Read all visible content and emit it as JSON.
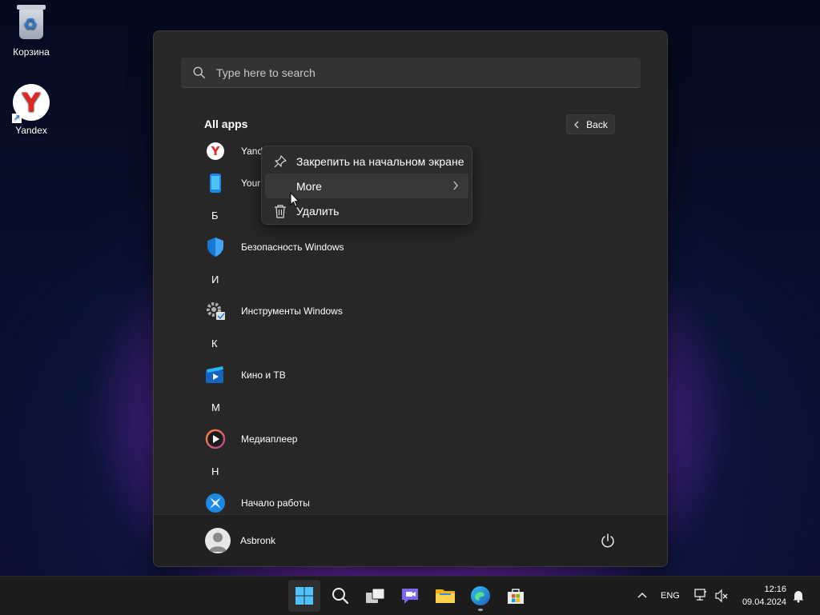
{
  "desktop": {
    "icons": [
      {
        "label": "Корзина"
      },
      {
        "label": "Yandex"
      }
    ]
  },
  "start_menu": {
    "search_placeholder": "Type here to search",
    "all_apps_title": "All apps",
    "back_label": "Back",
    "apps": [
      {
        "type": "app",
        "label": "Yandex",
        "visible_label": "Yand",
        "icon": "yandex-icon"
      },
      {
        "type": "app",
        "label": "Your Phone",
        "visible_label": "Your",
        "icon": "phone-link-icon"
      },
      {
        "type": "letter",
        "label": "Б"
      },
      {
        "type": "app",
        "label": "Безопасность Windows",
        "icon": "shield-icon"
      },
      {
        "type": "letter",
        "label": "И"
      },
      {
        "type": "app",
        "label": "Инструменты Windows",
        "icon": "tools-gear-icon"
      },
      {
        "type": "letter",
        "label": "К"
      },
      {
        "type": "app",
        "label": "Кино и ТВ",
        "icon": "film-icon"
      },
      {
        "type": "letter",
        "label": "М"
      },
      {
        "type": "app",
        "label": "Медиаплеер",
        "icon": "media-player-icon"
      },
      {
        "type": "letter",
        "label": "Н"
      },
      {
        "type": "app",
        "label": "Начало работы",
        "icon": "get-started-icon"
      }
    ],
    "user_name": "Asbronk"
  },
  "context_menu": {
    "pin_label": "Закрепить на начальном экране",
    "more_label": "More",
    "uninstall_label": "Удалить"
  },
  "taskbar": {
    "apps": [
      "windows-start-icon",
      "search-icon",
      "task-view-icon",
      "chat-icon",
      "file-explorer-icon",
      "edge-icon",
      "store-icon"
    ],
    "language": "ENG",
    "time": "12:16",
    "date": "09.04.2024"
  }
}
